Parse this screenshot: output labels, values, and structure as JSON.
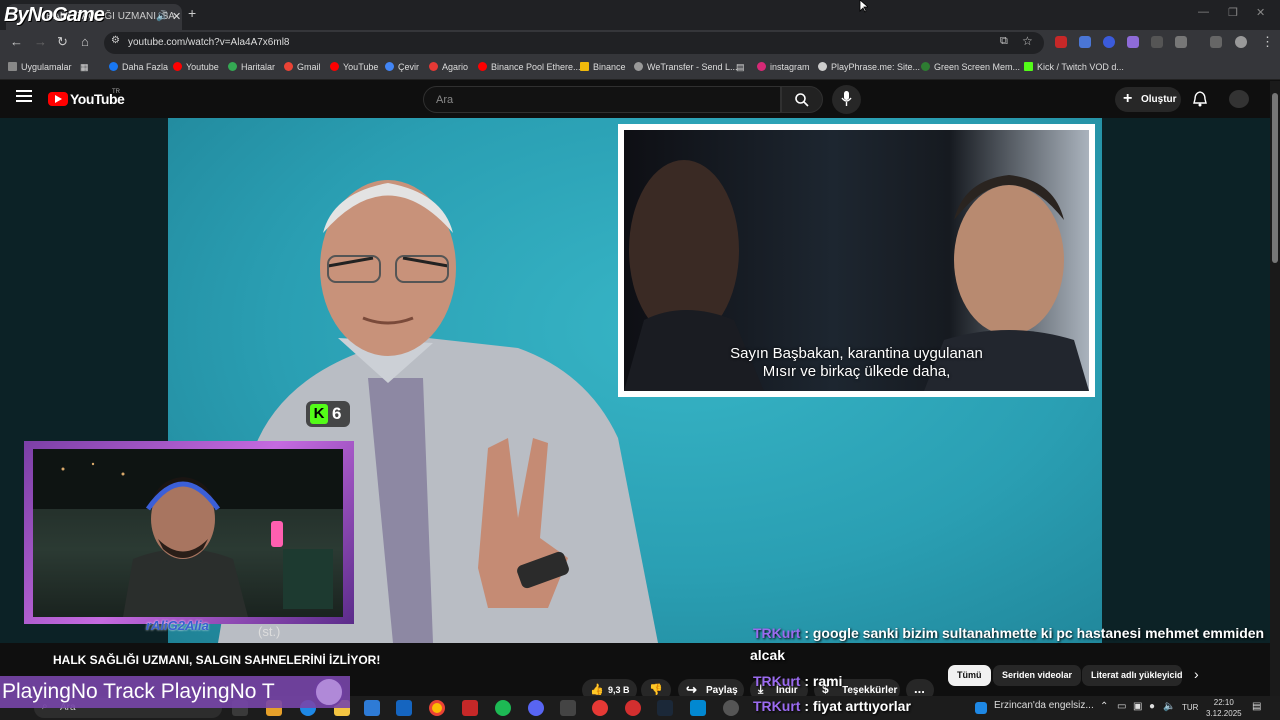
{
  "browser": {
    "tab_title": "HALK SAĞLIĞI UZMANI, SA",
    "stream_logo": "ByNoGame",
    "url": "youtube.com/watch?v=Ala4A7x6ml8",
    "bookmarks": [
      "Uygulamalar",
      "Daha Fazla",
      "Youtube",
      "Haritalar",
      "Gmail",
      "YouTube",
      "Çevir",
      "Agario",
      "Binance Pool Ethere...",
      "Binance",
      "WeTransfer - Send L...",
      "instagram",
      "PlayPhrase.me: Site...",
      "Green Screen Mem...",
      "Kick / Twitch VOD d..."
    ]
  },
  "youtube": {
    "wordmark": "YouTube",
    "region": "TR",
    "search_placeholder": "Ara",
    "create_label": "Oluştur",
    "video_title": "HALK SAĞLIĞI UZMANI, SALGIN SAHNELERİNİ İZLİYOR!",
    "like_count": "9,3 B",
    "share_label": "Paylaş",
    "download_label": "İndir",
    "thanks_label": "Teşekkürler",
    "more_label": "...",
    "chips": [
      "Tümü",
      "Seriden videolar",
      "Literat adlı yükleyicid"
    ]
  },
  "overlay": {
    "kick_badge": "K",
    "kick_viewers": "6",
    "subtitle_line1": "Sayın Başbakan, karantina uygulanan",
    "subtitle_line2": "Mısır ve birkaç ülkede daha,",
    "webcam_name": "rAliG2Alia",
    "webcam_tag": "(st.)",
    "music_text": "PlayingNo Track PlayingNo T"
  },
  "chat": [
    {
      "user": "TRKurt",
      "message": " : google sanki bizim sultanahmette ki pc hastanesi mehmet emmiden"
    },
    {
      "user": "",
      "message": "alcak"
    },
    {
      "user": "TRKurt",
      "message": " : rami"
    },
    {
      "user": "TRKurt",
      "message": " : fiyat arttıyorlar"
    }
  ],
  "taskbar": {
    "search_label": "Ara",
    "news": "Erzincan'da engelsiz...",
    "lang": "TUR",
    "time": "22:10",
    "date": "3.12.2025"
  },
  "colors": {
    "youtube_red": "#ff0000",
    "kick_green": "#53fc18",
    "chat_user": "#9b6bf0",
    "webcam_border": "#c56ae0"
  }
}
